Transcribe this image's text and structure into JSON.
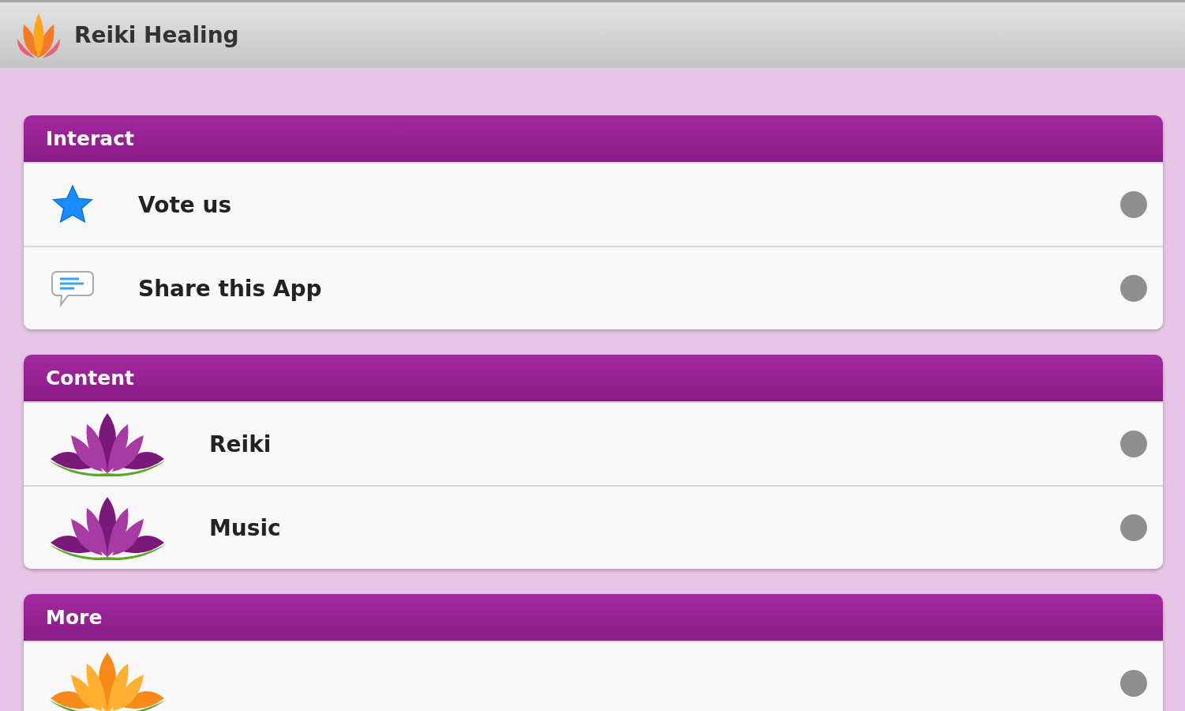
{
  "app_bar": {
    "title": "Reiki Healing"
  },
  "sections": [
    {
      "title": "Interact",
      "items": [
        {
          "kind": "star",
          "label": "Vote us"
        },
        {
          "kind": "chat",
          "label": "Share this App"
        }
      ]
    },
    {
      "title": "Content",
      "items": [
        {
          "kind": "lotus",
          "label": "Reiki"
        },
        {
          "kind": "lotus",
          "label": "Music"
        }
      ]
    },
    {
      "title": "More",
      "items": [
        {
          "kind": "flower"
        }
      ]
    }
  ]
}
